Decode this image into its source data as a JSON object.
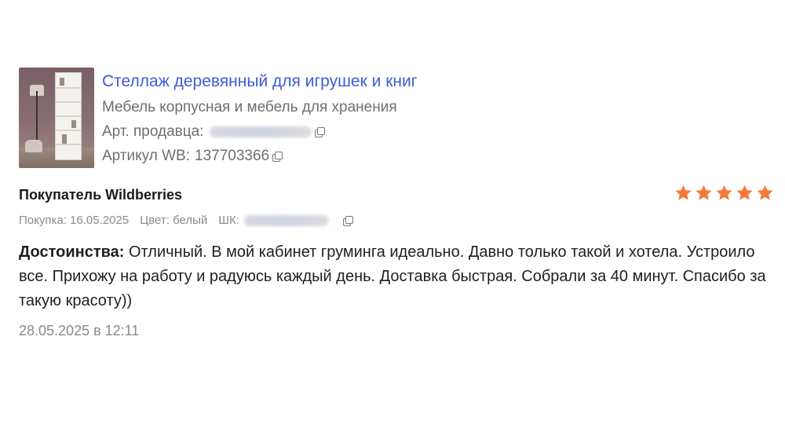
{
  "product": {
    "title": "Стеллаж деревянный для игрушек и книг",
    "category": "Мебель корпусная и мебель для хранения",
    "seller_article_label": "Арт. продавца:",
    "wb_article_label": "Артикул WB:",
    "wb_article_value": "137703366"
  },
  "review": {
    "author": "Покупатель Wildberries",
    "rating": 5,
    "purchase": "Покупка: 16.05.2025",
    "color": "Цвет: белый",
    "shk_label": "ШК:",
    "pros_label": "Достоинства:",
    "pros_text": "Отличный. В мой кабинет груминга идеально. Давно только такой и хотела. Устроило все. Прихожу на работу и радуюсь каждый день. Доставка быстрая. Собрали за 40 минут. Спасибо за такую красоту))",
    "date": "28.05.2025 в 12:11"
  },
  "icons": {
    "copy": "copy-icon",
    "star": "star-icon"
  },
  "colors": {
    "title_link": "#3f5cd8",
    "star": "#f47a3a",
    "muted_text": "#8a8a8a"
  }
}
